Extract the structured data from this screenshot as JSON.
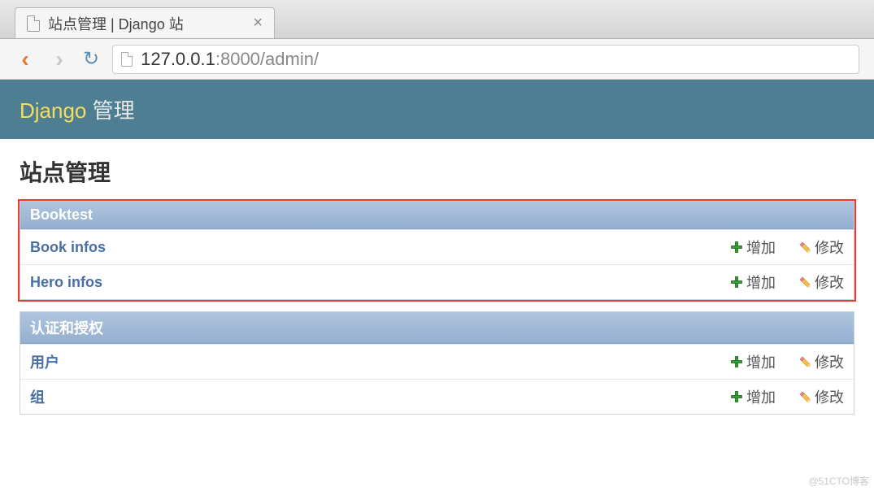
{
  "browser": {
    "tab_title": "站点管理 | Django 站",
    "url_host": "127.0.0.1",
    "url_port_path": ":8000/admin/"
  },
  "header": {
    "brand_prefix": "Django",
    "brand_suffix": " 管理"
  },
  "page_title": "站点管理",
  "modules": [
    {
      "caption": "Booktest",
      "highlight": true,
      "rows": [
        {
          "name": "Book infos",
          "add": "增加",
          "change": "修改"
        },
        {
          "name": "Hero infos",
          "add": "增加",
          "change": "修改"
        }
      ]
    },
    {
      "caption": "认证和授权",
      "highlight": false,
      "rows": [
        {
          "name": "用户",
          "add": "增加",
          "change": "修改"
        },
        {
          "name": "组",
          "add": "增加",
          "change": "修改"
        }
      ]
    }
  ],
  "watermark": "@51CTO博客"
}
